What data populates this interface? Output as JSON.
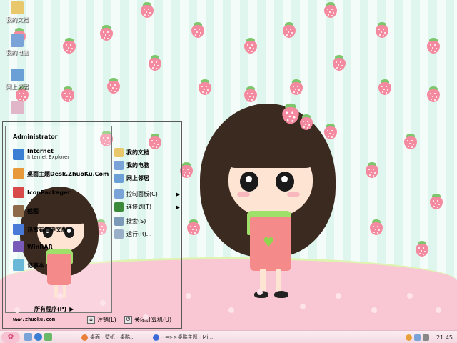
{
  "desktop": {
    "icons": [
      {
        "label": "我的文档",
        "color": "#e8c86a"
      },
      {
        "label": "我的电脑",
        "color": "#7aa4d8"
      },
      {
        "label": "网上邻居",
        "color": "#6aa0d6"
      },
      {
        "label": "",
        "color": "#e0b6c8"
      }
    ]
  },
  "start_menu": {
    "user": "Administrator",
    "left_items": [
      {
        "title": "Internet",
        "subtitle": "Internet Explorer",
        "color": "#3b7fd4"
      },
      {
        "title": "桌面主题Desk.ZhuoKu.Com",
        "subtitle": "",
        "color": "#e89a3a"
      },
      {
        "title": "IconPackager",
        "subtitle": "",
        "color": "#d84a4a"
      },
      {
        "title": "截图",
        "subtitle": "",
        "color": "#8c6a4a"
      },
      {
        "title": "迅雷看看中文版",
        "subtitle": "",
        "color": "#4a7ad8"
      },
      {
        "title": "WinRAR",
        "subtitle": "",
        "color": "#7a5ab8"
      },
      {
        "title": "记事本",
        "subtitle": "",
        "color": "#6ab8d8"
      }
    ],
    "all_programs": "所有程序(P)",
    "right_items": [
      {
        "label": "我的文档",
        "bold": true,
        "color": "#e8c86a"
      },
      {
        "label": "我的电脑",
        "bold": true,
        "color": "#7aa4d8"
      },
      {
        "label": "网上邻居",
        "bold": true,
        "color": "#6aa0d6"
      },
      {
        "label": "控制面板(C)",
        "bold": false,
        "color": "#7aa4d8"
      },
      {
        "label": "连接到(T)",
        "bold": false,
        "color": "#3b8a3b"
      },
      {
        "label": "搜索(S)",
        "bold": false,
        "color": "#7a9ab8"
      },
      {
        "label": "运行(R)...",
        "bold": false,
        "color": "#9ab0c8"
      }
    ],
    "website": "www.zhuoku.com",
    "log_off": "注销(L)",
    "shut_down": "关闭计算机(U)"
  },
  "taskbar": {
    "tasks": [
      {
        "label": "桌面 - 壁纸 - 桌酷...",
        "color": "#e8803a"
      },
      {
        "label": "--=>>桌酷主题 - Mi...",
        "color": "#3b6ad8"
      }
    ],
    "clock": "21:45"
  }
}
